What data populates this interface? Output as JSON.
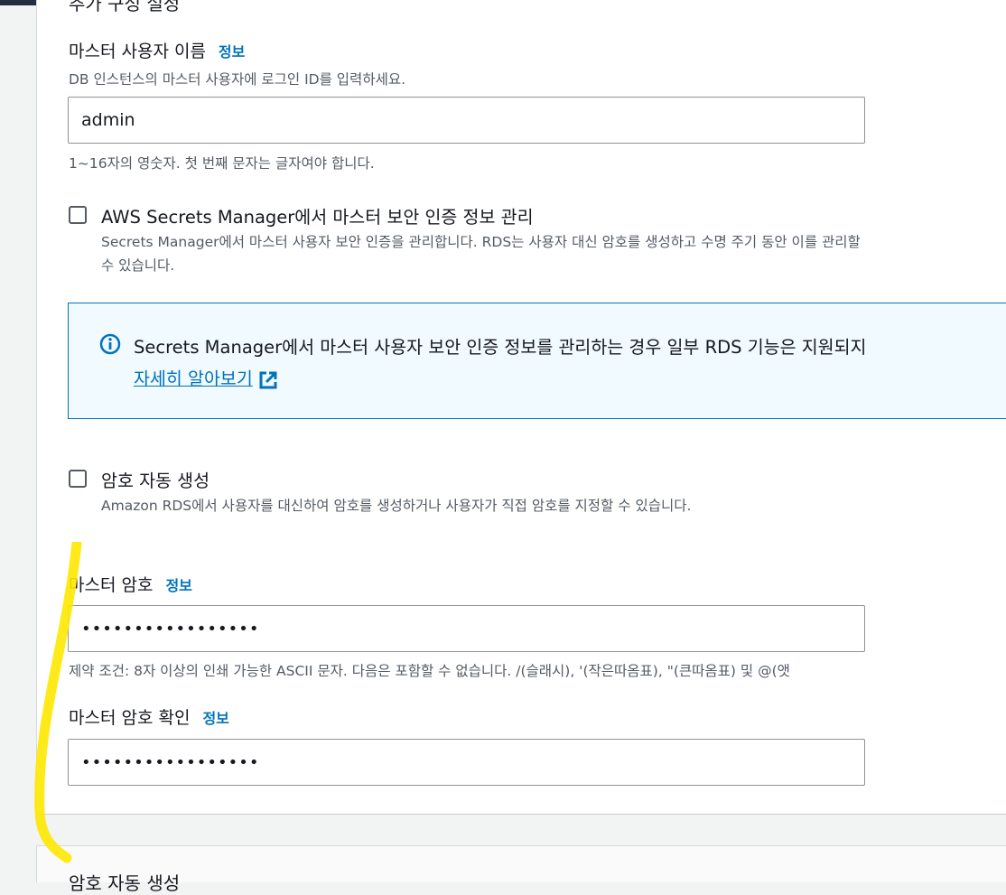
{
  "section_prev_heading": "추가 구성 설정",
  "username": {
    "label": "마스터 사용자 이름",
    "info": "정보",
    "description": "DB 인스턴스의 마스터 사용자에 로그인 ID를 입력하세요.",
    "value": "admin",
    "constraint": "1~16자의 영숫자. 첫 번째 문자는 글자여야 합니다."
  },
  "secrets_manager": {
    "title": "AWS Secrets Manager에서 마스터 보안 인증 정보 관리",
    "description": "Secrets Manager에서 마스터 사용자 보안 인증을 관리합니다. RDS는 사용자 대신 암호를 생성하고 수명 주기 동안 이를 관리할 수 있습니다.",
    "checked": false
  },
  "alert": {
    "icon": "info-icon",
    "text": "Secrets Manager에서 마스터 사용자 보안 인증 정보를 관리하는 경우 일부 RDS 기능은 지원되지",
    "link": "자세히 알아보기",
    "link_icon": "external-link-icon",
    "accent_color": "#0073bb"
  },
  "auto_password": {
    "title": "암호 자동 생성",
    "description": "Amazon RDS에서 사용자를 대신하여 암호를 생성하거나 사용자가 직접 암호를 지정할 수 있습니다.",
    "checked": false
  },
  "master_password": {
    "label": "마스터 암호",
    "info": "정보",
    "value": "•••••••••••••••••",
    "constraint": "제약 조건: 8자 이상의 인쇄 가능한 ASCII 문자. 다음은 포함할 수 없습니다. /(슬래시), '(작은따옴표), \"(큰따옴표) 및 @(앳"
  },
  "confirm_password": {
    "label": "마스터 암호 확인",
    "info": "정보",
    "value": "•••••••••••••••••"
  },
  "next_section_heading": "암호 자동 생성"
}
